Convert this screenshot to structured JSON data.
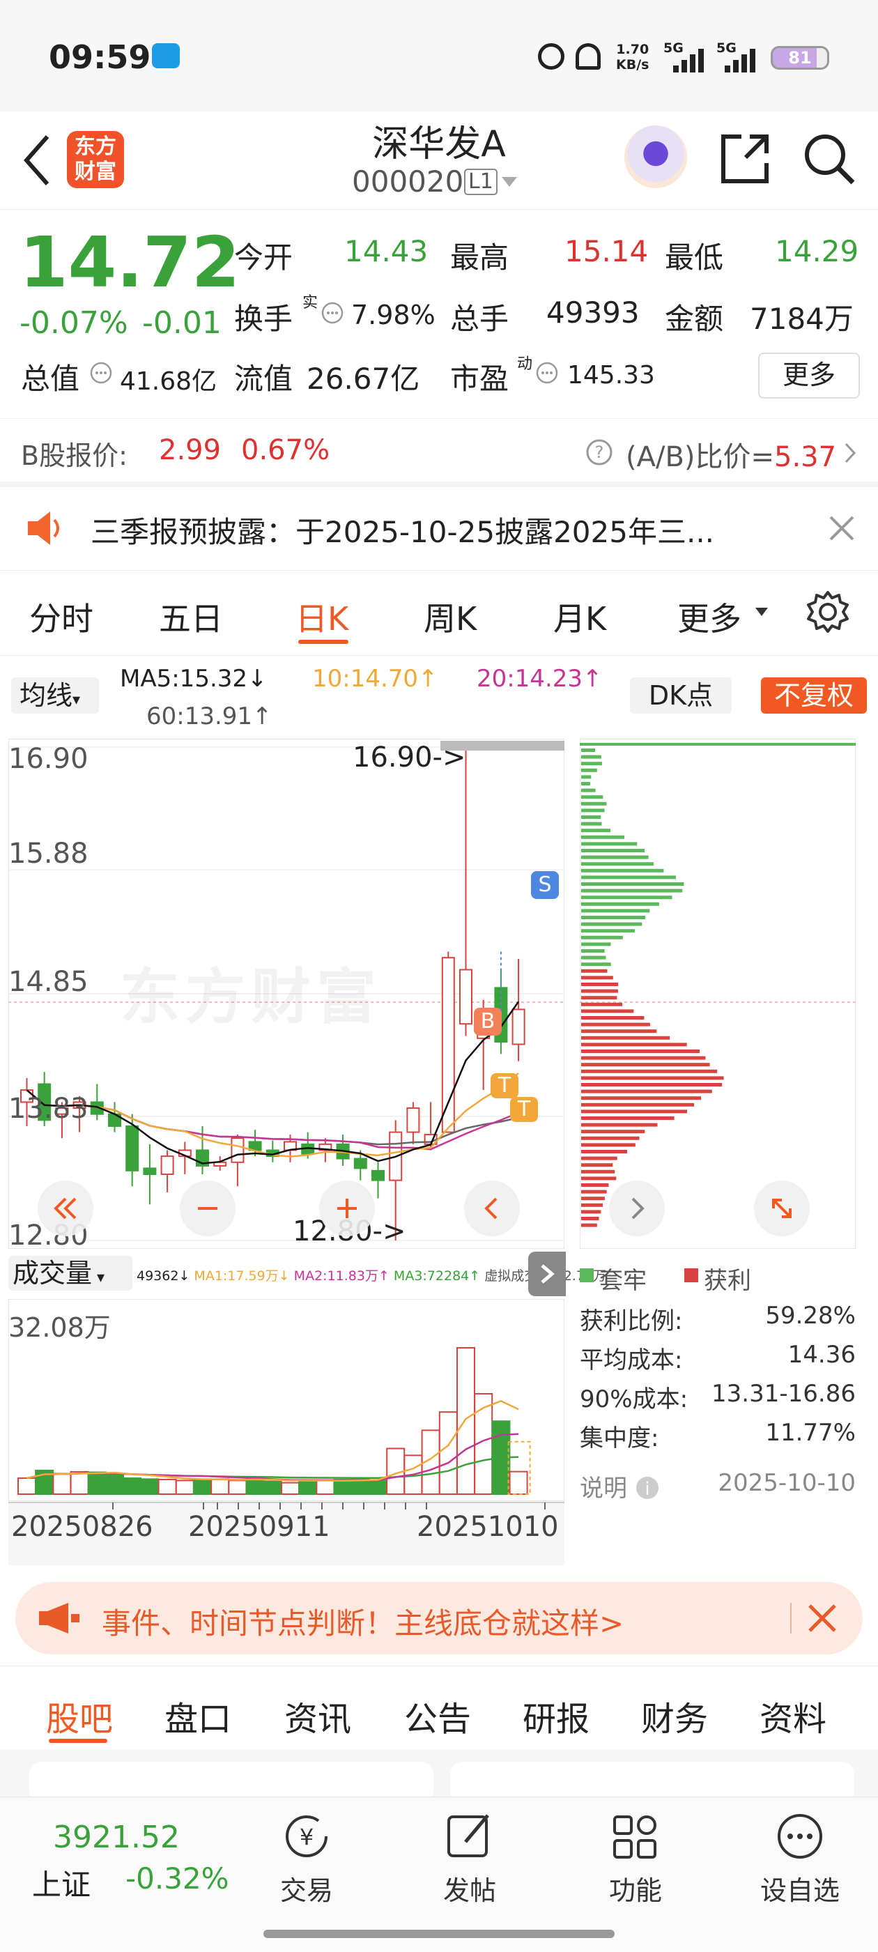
{
  "status_bar": {
    "time": "09:59",
    "net_speed_value": "1.70",
    "net_speed_unit": "KB/s",
    "sig1": "5G",
    "sig2": "5G",
    "battery": "81"
  },
  "header": {
    "back_icon": "chevron-left-icon",
    "logo_text1": "东方",
    "logo_text2": "财富",
    "title": "深华发A",
    "code": "000020",
    "level_badge": "L1"
  },
  "quote": {
    "price": "14.72",
    "change_pct": "-0.07%",
    "change": "-0.01",
    "open_label": "今开",
    "open": "14.43",
    "high_label": "最高",
    "high": "15.14",
    "low_label": "最低",
    "low": "14.29",
    "turnover_label": "换手",
    "turnover_sup": "实",
    "turnover": "7.98%",
    "volume_label": "总手",
    "volume": "49393",
    "amount_label": "金额",
    "amount": "7184万",
    "mktcap_label": "总值",
    "mktcap": "41.68亿",
    "float_label": "流值",
    "float": "26.67亿",
    "pe_label": "市盈",
    "pe_sup": "动",
    "pe": "145.33",
    "more_button": "更多"
  },
  "bshare": {
    "label": "B股报价:",
    "price": "2.99",
    "pct": "0.67%",
    "ratio_label": "(A/B)比价=",
    "ratio": "5.37"
  },
  "notice": {
    "text": "三季报预披露：于2025-10-25披露2025年三..."
  },
  "tabs": [
    "分时",
    "五日",
    "日K",
    "周K",
    "月K",
    "更多"
  ],
  "active_tab": "日K",
  "ma_bar": {
    "selector": "均线",
    "ma5": "MA5:15.32↓",
    "ma10": "10:14.70↑",
    "ma20": "20:14.23↑",
    "ma60": "60:13.91↑",
    "dk_button": "DK点",
    "fq_button": "不复权"
  },
  "chart": {
    "y_labels": [
      "16.90",
      "15.88",
      "14.85",
      "13.83",
      "12.80"
    ],
    "high_marker": "16.90->",
    "low_marker": "12.80->",
    "watermark": "东方财富",
    "badges": {
      "s": "S",
      "b": "B",
      "t1": "T",
      "t2": "T"
    }
  },
  "volume_bar": {
    "selector": "成交量",
    "vol": "49362↓",
    "ma1": "MA1:17.59万↓",
    "ma2": "MA2:11.83万↑",
    "ma3": "MA3:72284↑",
    "virtual": "虚拟成交量:12.78万",
    "max_label": "32.08万"
  },
  "x_labels": [
    "20250826",
    "20250911",
    "20251010"
  ],
  "chip": {
    "legend_trapped": "套牢",
    "legend_profit": "获利",
    "rows": [
      {
        "label": "获利比例:",
        "value": "59.28%"
      },
      {
        "label": "平均成本:",
        "value": "14.36"
      },
      {
        "label": "90%成本:",
        "value": "13.31-16.86"
      },
      {
        "label": "集中度:",
        "value": "11.77%"
      }
    ],
    "note": "说明",
    "date": "2025-10-10"
  },
  "promo": {
    "text": "事件、时间节点判断！主线底仓就这样>"
  },
  "bottom_tabs": [
    "股吧",
    "盘口",
    "资讯",
    "公告",
    "研报",
    "财务",
    "资料"
  ],
  "bottom_nav": {
    "index_value": "3921.52",
    "index_name": "上证",
    "index_change": "-0.32%",
    "items": [
      {
        "label": "交易",
        "icon": "yen-cycle-icon"
      },
      {
        "label": "发帖",
        "icon": "edit-icon"
      },
      {
        "label": "功能",
        "icon": "grid-icon"
      },
      {
        "label": "设自选",
        "icon": "more-dots-icon"
      }
    ]
  },
  "chart_data": {
    "type": "candlestick",
    "title": "",
    "ylim": [
      12.8,
      16.9
    ],
    "candles": [
      {
        "o": 13.95,
        "h": 14.15,
        "l": 13.75,
        "c": 14.05
      },
      {
        "o": 14.1,
        "h": 14.2,
        "l": 13.75,
        "c": 13.8
      },
      {
        "o": 13.85,
        "h": 13.95,
        "l": 13.65,
        "c": 13.9
      },
      {
        "o": 13.9,
        "h": 14.0,
        "l": 13.7,
        "c": 13.95
      },
      {
        "o": 13.95,
        "h": 14.1,
        "l": 13.8,
        "c": 13.85
      },
      {
        "o": 13.85,
        "h": 13.95,
        "l": 13.7,
        "c": 13.75
      },
      {
        "o": 13.75,
        "h": 13.85,
        "l": 13.25,
        "c": 13.38
      },
      {
        "o": 13.4,
        "h": 13.6,
        "l": 13.1,
        "c": 13.35
      },
      {
        "o": 13.35,
        "h": 13.55,
        "l": 13.2,
        "c": 13.5
      },
      {
        "o": 13.5,
        "h": 13.62,
        "l": 13.35,
        "c": 13.55
      },
      {
        "o": 13.55,
        "h": 13.75,
        "l": 13.35,
        "c": 13.42
      },
      {
        "o": 13.42,
        "h": 13.5,
        "l": 13.38,
        "c": 13.45
      },
      {
        "o": 13.45,
        "h": 13.68,
        "l": 13.25,
        "c": 13.65
      },
      {
        "o": 13.62,
        "h": 13.72,
        "l": 13.5,
        "c": 13.55
      },
      {
        "o": 13.55,
        "h": 13.63,
        "l": 13.45,
        "c": 13.5
      },
      {
        "o": 13.55,
        "h": 13.68,
        "l": 13.45,
        "c": 13.62
      },
      {
        "o": 13.6,
        "h": 13.7,
        "l": 13.48,
        "c": 13.52
      },
      {
        "o": 13.55,
        "h": 13.65,
        "l": 13.45,
        "c": 13.6
      },
      {
        "o": 13.6,
        "h": 13.68,
        "l": 13.42,
        "c": 13.48
      },
      {
        "o": 13.48,
        "h": 13.55,
        "l": 13.3,
        "c": 13.4
      },
      {
        "o": 13.38,
        "h": 13.45,
        "l": 13.15,
        "c": 13.3
      },
      {
        "o": 13.3,
        "h": 13.8,
        "l": 12.8,
        "c": 13.7
      },
      {
        "o": 13.7,
        "h": 13.95,
        "l": 13.6,
        "c": 13.9
      },
      {
        "o": 13.6,
        "h": 13.95,
        "l": 13.55,
        "c": 13.68
      },
      {
        "o": 13.7,
        "h": 15.2,
        "l": 13.7,
        "c": 15.15
      },
      {
        "o": 14.6,
        "h": 16.9,
        "l": 14.5,
        "c": 15.05
      },
      {
        "o": 14.48,
        "h": 14.8,
        "l": 14.05,
        "c": 14.55
      },
      {
        "o": 14.9,
        "h": 15.05,
        "l": 14.35,
        "c": 14.45
      },
      {
        "o": 14.43,
        "h": 15.14,
        "l": 14.29,
        "c": 14.72
      }
    ],
    "volume": [
      3.5,
      5.2,
      4.5,
      4.9,
      4.8,
      4.2,
      3.5,
      3.3,
      3.2,
      3.0,
      3.3,
      3.3,
      3.0,
      3.5,
      2.8,
      2.5,
      3.0,
      3.1,
      3.2,
      3.3,
      3.0,
      10.0,
      8.5,
      14.0,
      18.0,
      32.08,
      22.0,
      16.0,
      4.94
    ],
    "y2lim": [
      0,
      32.08
    ]
  }
}
